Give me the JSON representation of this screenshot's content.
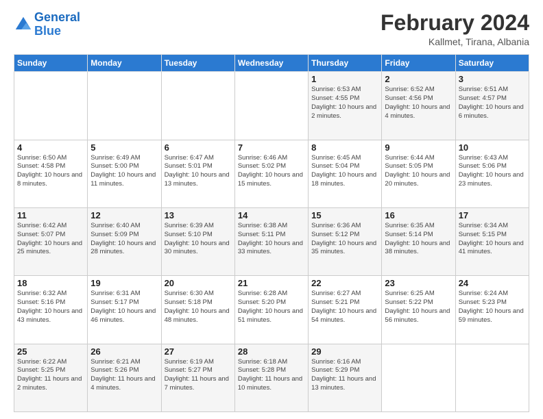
{
  "logo": {
    "line1": "General",
    "line2": "Blue"
  },
  "title": "February 2024",
  "subtitle": "Kallmet, Tirana, Albania",
  "days_of_week": [
    "Sunday",
    "Monday",
    "Tuesday",
    "Wednesday",
    "Thursday",
    "Friday",
    "Saturday"
  ],
  "weeks": [
    [
      {
        "day": "",
        "info": ""
      },
      {
        "day": "",
        "info": ""
      },
      {
        "day": "",
        "info": ""
      },
      {
        "day": "",
        "info": ""
      },
      {
        "day": "1",
        "info": "Sunrise: 6:53 AM\nSunset: 4:55 PM\nDaylight: 10 hours\nand 2 minutes."
      },
      {
        "day": "2",
        "info": "Sunrise: 6:52 AM\nSunset: 4:56 PM\nDaylight: 10 hours\nand 4 minutes."
      },
      {
        "day": "3",
        "info": "Sunrise: 6:51 AM\nSunset: 4:57 PM\nDaylight: 10 hours\nand 6 minutes."
      }
    ],
    [
      {
        "day": "4",
        "info": "Sunrise: 6:50 AM\nSunset: 4:58 PM\nDaylight: 10 hours\nand 8 minutes."
      },
      {
        "day": "5",
        "info": "Sunrise: 6:49 AM\nSunset: 5:00 PM\nDaylight: 10 hours\nand 11 minutes."
      },
      {
        "day": "6",
        "info": "Sunrise: 6:47 AM\nSunset: 5:01 PM\nDaylight: 10 hours\nand 13 minutes."
      },
      {
        "day": "7",
        "info": "Sunrise: 6:46 AM\nSunset: 5:02 PM\nDaylight: 10 hours\nand 15 minutes."
      },
      {
        "day": "8",
        "info": "Sunrise: 6:45 AM\nSunset: 5:04 PM\nDaylight: 10 hours\nand 18 minutes."
      },
      {
        "day": "9",
        "info": "Sunrise: 6:44 AM\nSunset: 5:05 PM\nDaylight: 10 hours\nand 20 minutes."
      },
      {
        "day": "10",
        "info": "Sunrise: 6:43 AM\nSunset: 5:06 PM\nDaylight: 10 hours\nand 23 minutes."
      }
    ],
    [
      {
        "day": "11",
        "info": "Sunrise: 6:42 AM\nSunset: 5:07 PM\nDaylight: 10 hours\nand 25 minutes."
      },
      {
        "day": "12",
        "info": "Sunrise: 6:40 AM\nSunset: 5:09 PM\nDaylight: 10 hours\nand 28 minutes."
      },
      {
        "day": "13",
        "info": "Sunrise: 6:39 AM\nSunset: 5:10 PM\nDaylight: 10 hours\nand 30 minutes."
      },
      {
        "day": "14",
        "info": "Sunrise: 6:38 AM\nSunset: 5:11 PM\nDaylight: 10 hours\nand 33 minutes."
      },
      {
        "day": "15",
        "info": "Sunrise: 6:36 AM\nSunset: 5:12 PM\nDaylight: 10 hours\nand 35 minutes."
      },
      {
        "day": "16",
        "info": "Sunrise: 6:35 AM\nSunset: 5:14 PM\nDaylight: 10 hours\nand 38 minutes."
      },
      {
        "day": "17",
        "info": "Sunrise: 6:34 AM\nSunset: 5:15 PM\nDaylight: 10 hours\nand 41 minutes."
      }
    ],
    [
      {
        "day": "18",
        "info": "Sunrise: 6:32 AM\nSunset: 5:16 PM\nDaylight: 10 hours\nand 43 minutes."
      },
      {
        "day": "19",
        "info": "Sunrise: 6:31 AM\nSunset: 5:17 PM\nDaylight: 10 hours\nand 46 minutes."
      },
      {
        "day": "20",
        "info": "Sunrise: 6:30 AM\nSunset: 5:18 PM\nDaylight: 10 hours\nand 48 minutes."
      },
      {
        "day": "21",
        "info": "Sunrise: 6:28 AM\nSunset: 5:20 PM\nDaylight: 10 hours\nand 51 minutes."
      },
      {
        "day": "22",
        "info": "Sunrise: 6:27 AM\nSunset: 5:21 PM\nDaylight: 10 hours\nand 54 minutes."
      },
      {
        "day": "23",
        "info": "Sunrise: 6:25 AM\nSunset: 5:22 PM\nDaylight: 10 hours\nand 56 minutes."
      },
      {
        "day": "24",
        "info": "Sunrise: 6:24 AM\nSunset: 5:23 PM\nDaylight: 10 hours\nand 59 minutes."
      }
    ],
    [
      {
        "day": "25",
        "info": "Sunrise: 6:22 AM\nSunset: 5:25 PM\nDaylight: 11 hours\nand 2 minutes."
      },
      {
        "day": "26",
        "info": "Sunrise: 6:21 AM\nSunset: 5:26 PM\nDaylight: 11 hours\nand 4 minutes."
      },
      {
        "day": "27",
        "info": "Sunrise: 6:19 AM\nSunset: 5:27 PM\nDaylight: 11 hours\nand 7 minutes."
      },
      {
        "day": "28",
        "info": "Sunrise: 6:18 AM\nSunset: 5:28 PM\nDaylight: 11 hours\nand 10 minutes."
      },
      {
        "day": "29",
        "info": "Sunrise: 6:16 AM\nSunset: 5:29 PM\nDaylight: 11 hours\nand 13 minutes."
      },
      {
        "day": "",
        "info": ""
      },
      {
        "day": "",
        "info": ""
      }
    ]
  ]
}
